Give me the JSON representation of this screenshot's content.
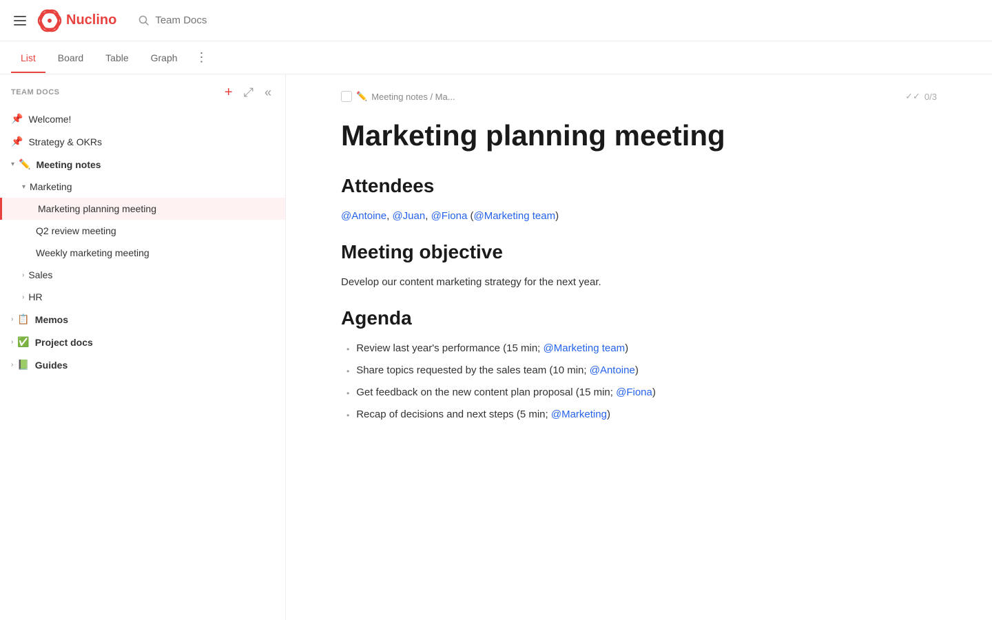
{
  "app": {
    "name": "Nuclino",
    "search_placeholder": "Team Docs"
  },
  "tabs": [
    {
      "id": "list",
      "label": "List",
      "active": true
    },
    {
      "id": "board",
      "label": "Board",
      "active": false
    },
    {
      "id": "table",
      "label": "Table",
      "active": false
    },
    {
      "id": "graph",
      "label": "Graph",
      "active": false
    }
  ],
  "sidebar": {
    "workspace_title": "TEAM DOCS",
    "add_button_label": "+",
    "items": [
      {
        "id": "welcome",
        "label": "Welcome!",
        "icon": "📌",
        "indent": 0,
        "pinned": true
      },
      {
        "id": "strategy",
        "label": "Strategy & OKRs",
        "icon": "📌",
        "indent": 0,
        "pinned": true
      },
      {
        "id": "meeting-notes",
        "label": "Meeting notes",
        "icon": "✏️",
        "indent": 0,
        "expanded": true,
        "bold": true
      },
      {
        "id": "marketing",
        "label": "Marketing",
        "indent": 1,
        "expanded": true,
        "bold": false
      },
      {
        "id": "marketing-planning",
        "label": "Marketing planning meeting",
        "indent": 2,
        "active": true
      },
      {
        "id": "q2-review",
        "label": "Q2 review meeting",
        "indent": 2
      },
      {
        "id": "weekly-marketing",
        "label": "Weekly marketing meeting",
        "indent": 2
      },
      {
        "id": "sales",
        "label": "Sales",
        "indent": 1,
        "collapsed": true
      },
      {
        "id": "hr",
        "label": "HR",
        "indent": 1,
        "collapsed": true
      },
      {
        "id": "memos",
        "label": "Memos",
        "icon": "📋",
        "indent": 0,
        "collapsed": true,
        "bold": true
      },
      {
        "id": "project-docs",
        "label": "Project docs",
        "icon": "✅",
        "indent": 0,
        "collapsed": true,
        "bold": true
      },
      {
        "id": "guides",
        "label": "Guides",
        "icon": "📗",
        "indent": 0,
        "collapsed": true,
        "bold": true
      }
    ]
  },
  "document": {
    "breadcrumb": "Meeting notes / Ma...",
    "task_progress": "0/3",
    "title": "Marketing planning meeting",
    "sections": [
      {
        "id": "attendees",
        "heading": "Attendees",
        "type": "mentions",
        "mentions": [
          "@Antoine",
          "@Juan",
          "@Fiona"
        ],
        "group_mention": "@Marketing team"
      },
      {
        "id": "objective",
        "heading": "Meeting objective",
        "type": "paragraph",
        "text": "Develop our content marketing strategy for the next year."
      },
      {
        "id": "agenda",
        "heading": "Agenda",
        "type": "list",
        "items": [
          {
            "text": "Review last year's performance (15 min; ",
            "mention": "@Marketing team",
            "suffix": ")"
          },
          {
            "text": "Share topics requested by the sales team (10 min; ",
            "mention": "@Antoine",
            "suffix": ")"
          },
          {
            "text": "Get feedback on the new content plan proposal (15 min; ",
            "mention": "@Fiona",
            "suffix": ")"
          },
          {
            "text": "Recap of decisions and next steps (5 min; ",
            "mention": "@Marketing",
            "suffix": ")"
          }
        ]
      }
    ]
  },
  "icons": {
    "menu": "☰",
    "search": "🔍",
    "plus": "+",
    "expand": "⤢",
    "collapse": "«",
    "more": "⋮",
    "checkbox_empty": "☐",
    "double_check": "✓✓"
  }
}
